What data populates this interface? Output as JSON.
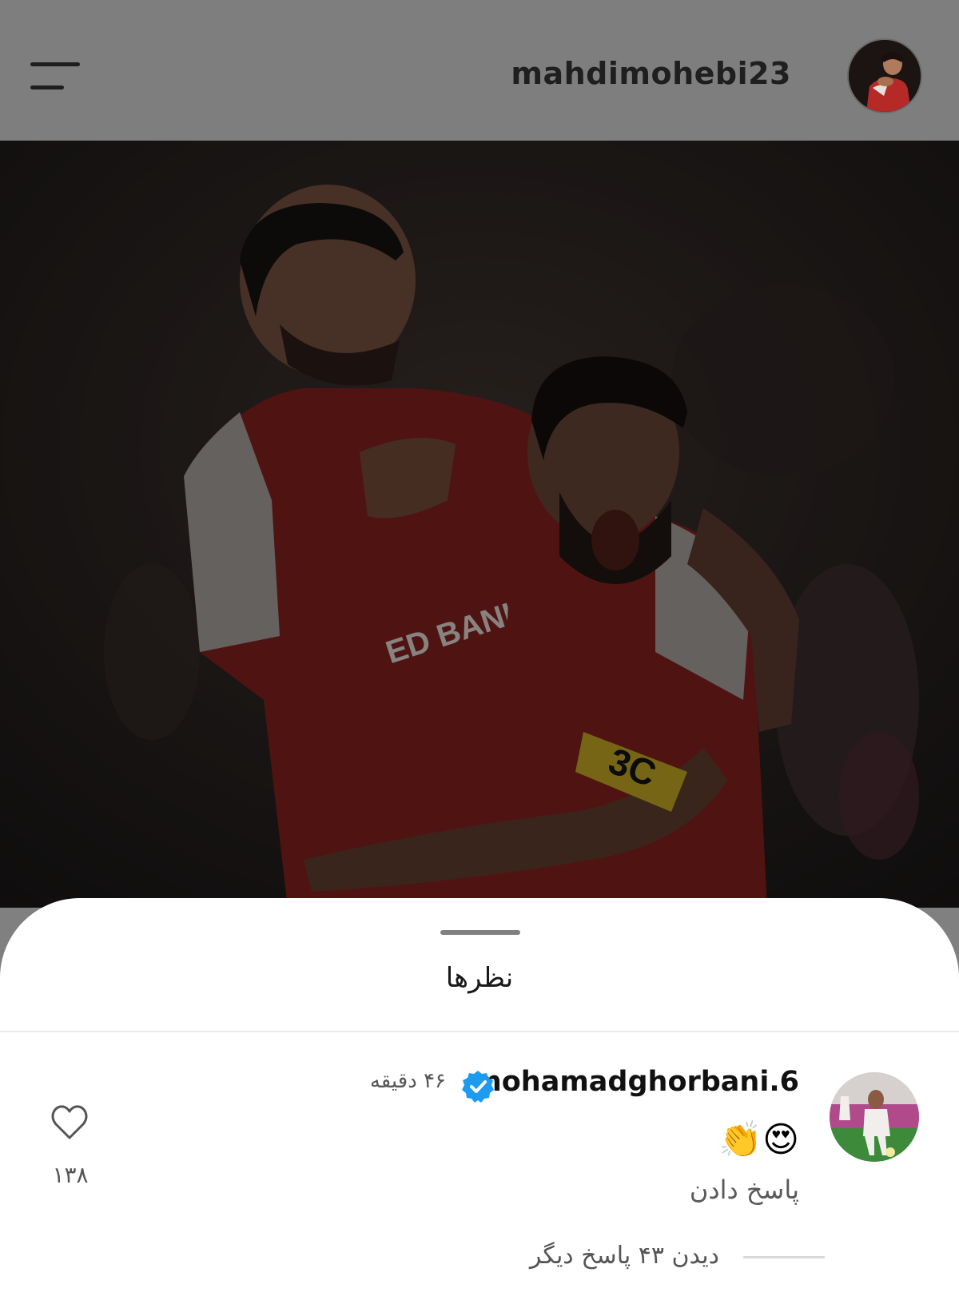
{
  "header": {
    "username": "mahdimohebi23",
    "menu_icon": "hamburger-menu-icon",
    "avatar_icon": "profile-avatar"
  },
  "post": {
    "image": "photo-two-players-celebrating",
    "jersey_text": "ED BANK",
    "armband_text": "3C"
  },
  "sheet": {
    "title": "نظرها"
  },
  "comment": {
    "username": "mohamadghorbani.6",
    "verified_icon": "verified-badge-icon",
    "time": "۴۶ دقیقه",
    "text": "😍👏",
    "reply_label": "پاسخ دادن",
    "like_icon": "heart-icon",
    "like_count": "۱۳۸",
    "more_replies_label": "دیدن ۴۳ پاسخ دیگر"
  },
  "colors": {
    "jersey_red": "#c8312c",
    "verified_blue": "#1d9bf0",
    "overlay_gray": "#808080"
  }
}
